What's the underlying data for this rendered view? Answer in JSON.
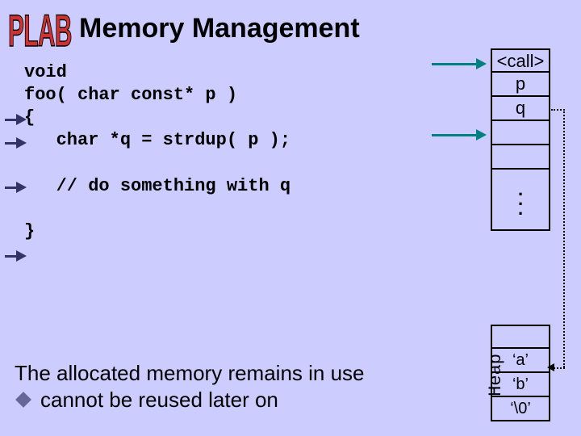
{
  "logo": "PLAB",
  "title": "Memory Management",
  "code": {
    "l1": "void",
    "l2": "foo( char const* p )",
    "l3": "{",
    "l4": "   char *q = strdup( p );",
    "l5": "",
    "l6": "   // do something with q",
    "l7": "",
    "l8": "}"
  },
  "statement": {
    "line1": "The allocated memory remains in use",
    "line2": "cannot be reused later on"
  },
  "stack": {
    "cells": [
      "<call>",
      "p",
      "q",
      "",
      ""
    ]
  },
  "heap": {
    "label": "Heap",
    "cells": [
      "",
      "‘a’",
      "‘b’",
      "‘\\0’"
    ]
  }
}
